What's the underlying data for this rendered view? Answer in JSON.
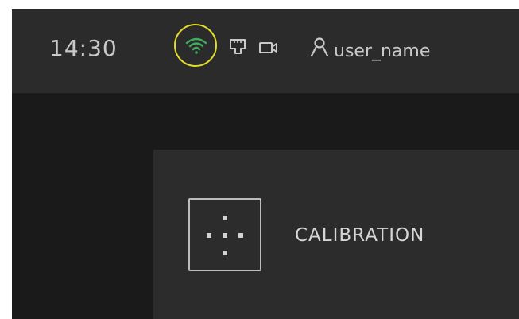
{
  "status_bar": {
    "time": "14:30",
    "user_name": "user_name",
    "icons": [
      "wifi-icon",
      "sd-card-icon",
      "camera-icon",
      "user-icon"
    ],
    "wifi_color": "#3fae5a",
    "highlight_color": "#e2dc2a"
  },
  "menu": {
    "items": [
      {
        "label": "CALIBRATION",
        "icon": "calibration-icon"
      }
    ]
  }
}
